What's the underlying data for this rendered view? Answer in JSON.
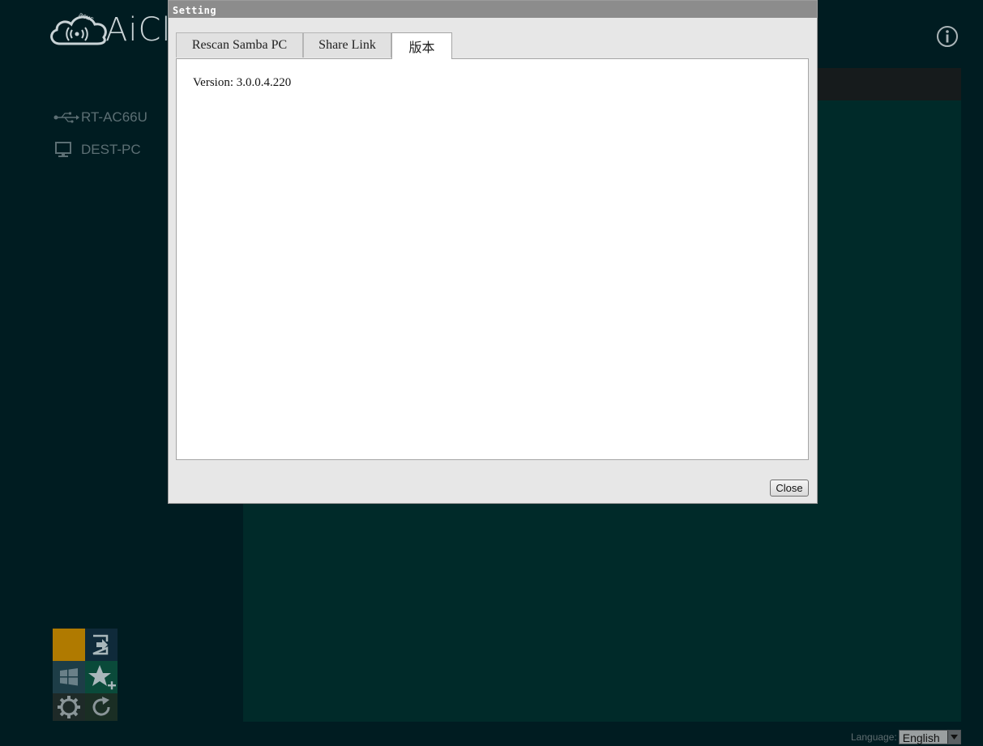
{
  "app": {
    "logo_brand": "asus",
    "logo_text": "AiCl",
    "info_icon": "info-circle-icon"
  },
  "sidebar": {
    "devices": [
      {
        "label": "RT-AC66U",
        "icon": "usb-icon"
      },
      {
        "label": "DEST-PC",
        "icon": "monitor-icon"
      }
    ]
  },
  "tiles": [
    {
      "icon": "blank-tile",
      "color": "#b07a00"
    },
    {
      "icon": "logout-icon",
      "color": "#0f2a3a"
    },
    {
      "icon": "windows-icon",
      "color": "#1d3d47"
    },
    {
      "icon": "add-favorite-icon",
      "color": "#0a4a3a"
    },
    {
      "icon": "gear-icon",
      "color": "#1e2a28"
    },
    {
      "icon": "refresh-icon",
      "color": "#1a2e24"
    }
  ],
  "footer": {
    "language_label": "Language:",
    "language_value": "English"
  },
  "dialog": {
    "title": "Setting",
    "tabs": [
      {
        "label": "Rescan Samba PC",
        "active": false
      },
      {
        "label": "Share Link",
        "active": false
      },
      {
        "label": "版本",
        "active": true
      }
    ],
    "version_text": "Version: 3.0.0.4.220",
    "close_label": "Close"
  },
  "colors": {
    "background": "#001c21",
    "content_header": "#161b1c",
    "content_main": "#002a29",
    "dialog_bg": "#e7e7e7",
    "titlebar": "#8c8c8c"
  }
}
